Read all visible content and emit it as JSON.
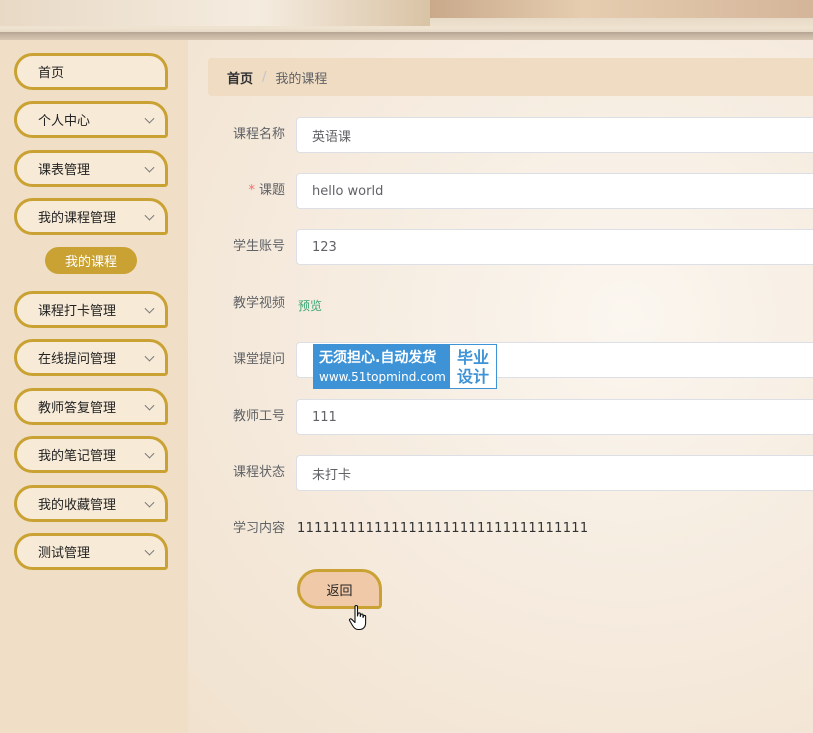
{
  "sidebar": {
    "items": [
      {
        "label": "首页",
        "has_arrow": false
      },
      {
        "label": "个人中心",
        "has_arrow": true
      },
      {
        "label": "课表管理",
        "has_arrow": true
      },
      {
        "label": "我的课程管理",
        "has_arrow": true
      },
      {
        "label": "课程打卡管理",
        "has_arrow": true
      },
      {
        "label": "在线提问管理",
        "has_arrow": true
      },
      {
        "label": "教师答复管理",
        "has_arrow": true
      },
      {
        "label": "我的笔记管理",
        "has_arrow": true
      },
      {
        "label": "我的收藏管理",
        "has_arrow": true
      },
      {
        "label": "测试管理",
        "has_arrow": true
      }
    ],
    "active_sub_item": "我的课程"
  },
  "breadcrumb": {
    "home": "首页",
    "separator": "/",
    "current": "我的课程"
  },
  "form": {
    "course_name": {
      "label": "课程名称",
      "value": "英语课"
    },
    "topic": {
      "label": "课题",
      "required_mark": "*",
      "value": "hello world"
    },
    "student_account": {
      "label": "学生账号",
      "value": "123"
    },
    "teaching_video": {
      "label": "教学视频",
      "link": "预览"
    },
    "classroom_question": {
      "label": "课堂提问",
      "value": ""
    },
    "teacher_id": {
      "label": "教师工号",
      "value": "111"
    },
    "course_status": {
      "label": "课程状态",
      "value": "未打卡"
    },
    "study_content": {
      "label": "学习内容",
      "value": "1111111111111111111111111111111111"
    }
  },
  "back_button": {
    "label": "返回"
  },
  "watermark": {
    "line1": "无须担心.自动发货",
    "line2": "www.51topmind.com",
    "right_top": "毕业",
    "right_bottom": "设计"
  },
  "colors": {
    "accent": "#c9a233",
    "sidebar_bg": "#f0dfc6",
    "breadcrumb_bg": "#efdcc2",
    "link": "#3aa776",
    "required": "#f56c6c",
    "watermark_blue": "#3d93d6"
  }
}
